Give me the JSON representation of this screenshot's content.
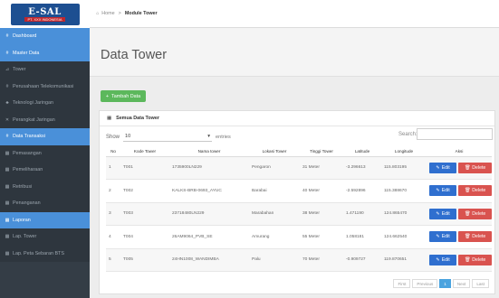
{
  "logo": {
    "main": "E-SAL",
    "sub": "PT. XXX INDONESIA"
  },
  "sidebar": {
    "items": [
      {
        "icon": "#",
        "label": "Dashboard"
      },
      {
        "icon": "#",
        "label": "Master Data"
      },
      {
        "icon": "⊿",
        "label": "Tower"
      },
      {
        "icon": "#",
        "label": "Perusahaan Telekomunikasi"
      },
      {
        "icon": "♣",
        "label": "Teknologi Jaringan"
      },
      {
        "icon": "✕",
        "label": "Perangkat Jaringan"
      },
      {
        "icon": "#",
        "label": "Data Transaksi"
      },
      {
        "icon": "▦",
        "label": "Pemasangan"
      },
      {
        "icon": "▦",
        "label": "Pemeliharaan"
      },
      {
        "icon": "▦",
        "label": "Retribusi"
      },
      {
        "icon": "▦",
        "label": "Penanganan"
      },
      {
        "icon": "▦",
        "label": "Laporan"
      },
      {
        "icon": "▦",
        "label": "Lap. Tower"
      },
      {
        "icon": "▦",
        "label": "Lap. Peta Sebaran BTS"
      }
    ]
  },
  "breadcrumb": {
    "home": "Home",
    "sep": ">",
    "current": "Module Tower"
  },
  "page": {
    "title": "Data Tower",
    "add_button": "Tambah Data",
    "panel_title": "Semua Data Tower",
    "show_label": "Show",
    "entries_value": "10",
    "entries_label": "entries",
    "search_label": "Search:"
  },
  "table": {
    "headers": [
      "No",
      "Kode Tower",
      "Nama tower",
      "Lokasi Tower",
      "Tinggi Tower",
      "Latitude",
      "Longitude",
      "Aksi"
    ],
    "rows": [
      {
        "no": "1",
        "kode": "T001",
        "nama": "1735900LN229",
        "lokasi": "Pengaron",
        "tinggi": "31 Meter",
        "lat": "-3.296613",
        "lng": "115.803195"
      },
      {
        "no": "2",
        "kode": "T002",
        "nama": "KALKS-BRB-0693_AYUC",
        "lokasi": "Barabai",
        "tinggi": "40 Meter",
        "lat": "-2.592896",
        "lng": "115.388670"
      },
      {
        "no": "3",
        "kode": "T003",
        "nama": "23718480LN229",
        "lokasi": "Marabahan",
        "tinggi": "38 Meter",
        "lat": "1.471190",
        "lng": "124.865470"
      },
      {
        "no": "4",
        "kode": "T004",
        "nama": "26AM9064_PVB_SE",
        "lokasi": "Amurang",
        "tinggi": "55 Meter",
        "lat": "1.058181",
        "lng": "124.662540"
      },
      {
        "no": "5",
        "kode": "T005",
        "nama": "24HN1008_WANDIMBA",
        "lokasi": "Palu",
        "tinggi": "70 Meter",
        "lat": "-0.909727",
        "lng": "119.870651"
      }
    ],
    "edit_label": "Edit",
    "delete_label": "Delete"
  },
  "pagination": {
    "first": "First",
    "prev": "Previous",
    "current": "1",
    "next": "Next",
    "last": "Last"
  },
  "colors": {
    "sidebar": "#343d46",
    "active_blue": "#4a90d9",
    "green": "#5cb85c",
    "edit": "#2f6fcf",
    "delete": "#d9534f"
  }
}
